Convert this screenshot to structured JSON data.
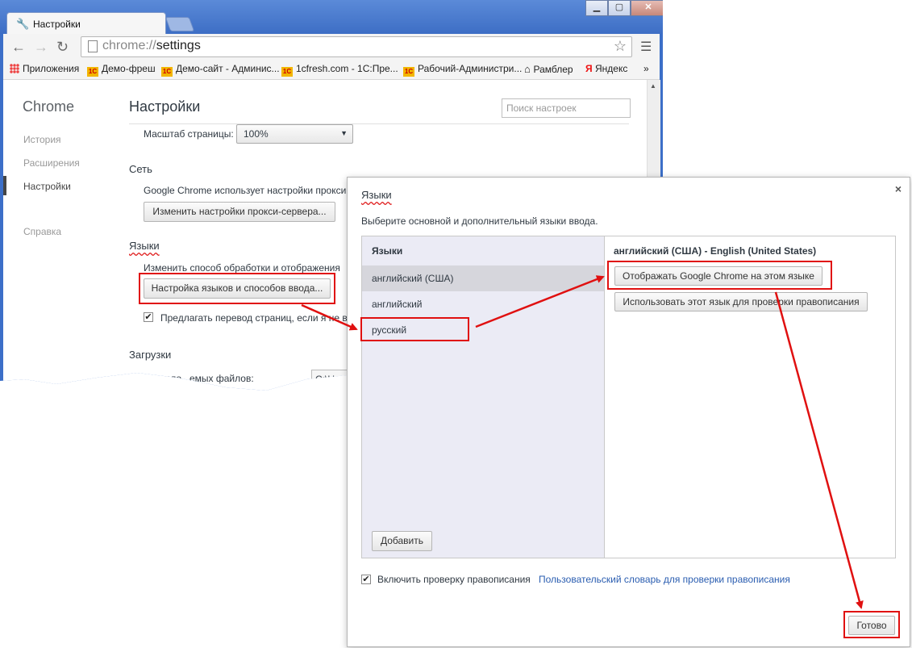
{
  "browser": {
    "tab_title": "Настройки",
    "url_scheme": "chrome://",
    "url_path": "settings",
    "window_buttons": [
      "▁",
      "▢",
      "✕"
    ]
  },
  "bookmarks": [
    {
      "label": "Приложения",
      "icon": "apps-icon"
    },
    {
      "label": "Демо-фреш",
      "icon": "1c-icon"
    },
    {
      "label": "Демо-сайт - Админис...",
      "icon": "1c-icon"
    },
    {
      "label": "1cfresh.com - 1С:Пре...",
      "icon": "1c-icon"
    },
    {
      "label": "Рабочий-Администри...",
      "icon": "1c-icon"
    },
    {
      "label": "Рамблер",
      "icon": "home-icon"
    },
    {
      "label": "Яндекс",
      "icon": "yandex-icon"
    }
  ],
  "bookmarks_more": "»",
  "sidebar": {
    "brand": "Chrome",
    "items": [
      {
        "label": "История"
      },
      {
        "label": "Расширения"
      },
      {
        "label": "Настройки",
        "selected": true
      },
      {
        "label": "Справка"
      }
    ]
  },
  "settings": {
    "title": "Настройки",
    "search_placeholder": "Поиск настроек",
    "zoom_label": "Масштаб страницы:",
    "zoom_value": "100%",
    "network_title": "Сеть",
    "network_text": "Google Chrome использует настройки прокси",
    "proxy_button": "Изменить настройки прокси-сервера...",
    "languages_title": "Языки",
    "languages_text": "Изменить способ обработки и отображения",
    "languages_button": "Настройка языков и способов ввода...",
    "translate_label": "Предлагать перевод страниц, если я не вл",
    "downloads_title": "Загрузки",
    "downloads_label": "Располо...емых файлов:",
    "downloads_value": "C:\\Us"
  },
  "dialog": {
    "title": "Языки",
    "subtitle": "Выберите основной и дополнительный языки ввода.",
    "list_header": "Языки",
    "languages": [
      "английский (США)",
      "английский",
      "русский"
    ],
    "add_button": "Добавить",
    "detail_title": "английский (США) - English (United States)",
    "display_button": "Отображать Google Chrome на этом языке",
    "spell_button": "Использовать этот язык для проверки правописания",
    "spellcheck_label": "Включить проверку правописания",
    "dictionary_link": "Пользовательский словарь для проверки правописания",
    "done_button": "Готово",
    "close_glyph": "×"
  },
  "colors": {
    "annotation": "#e01010",
    "window_frame": "#3c6fc8",
    "link": "#2a5db0"
  }
}
